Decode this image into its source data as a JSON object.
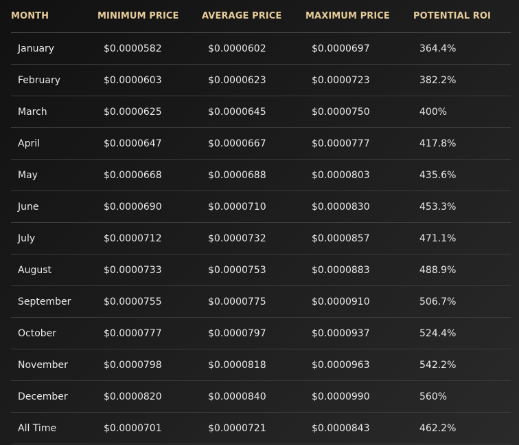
{
  "columns": {
    "month": "MONTH",
    "min": "MINIMUM PRICE",
    "avg": "AVERAGE PRICE",
    "max": "MAXIMUM PRICE",
    "roi": "POTENTIAL ROI"
  },
  "rows": [
    {
      "month": "January",
      "min": "$0.0000582",
      "avg": "$0.0000602",
      "max": "$0.0000697",
      "roi": "364.4%"
    },
    {
      "month": "February",
      "min": "$0.0000603",
      "avg": "$0.0000623",
      "max": "$0.0000723",
      "roi": "382.2%"
    },
    {
      "month": "March",
      "min": "$0.0000625",
      "avg": "$0.0000645",
      "max": "$0.0000750",
      "roi": "400%"
    },
    {
      "month": "April",
      "min": "$0.0000647",
      "avg": "$0.0000667",
      "max": "$0.0000777",
      "roi": "417.8%"
    },
    {
      "month": "May",
      "min": "$0.0000668",
      "avg": "$0.0000688",
      "max": "$0.0000803",
      "roi": "435.6%"
    },
    {
      "month": "June",
      "min": "$0.0000690",
      "avg": "$0.0000710",
      "max": "$0.0000830",
      "roi": "453.3%"
    },
    {
      "month": "July",
      "min": "$0.0000712",
      "avg": "$0.0000732",
      "max": "$0.0000857",
      "roi": "471.1%"
    },
    {
      "month": "August",
      "min": "$0.0000733",
      "avg": "$0.0000753",
      "max": "$0.0000883",
      "roi": "488.9%"
    },
    {
      "month": "September",
      "min": "$0.0000755",
      "avg": "$0.0000775",
      "max": "$0.0000910",
      "roi": "506.7%"
    },
    {
      "month": "October",
      "min": "$0.0000777",
      "avg": "$0.0000797",
      "max": "$0.0000937",
      "roi": "524.4%"
    },
    {
      "month": "November",
      "min": "$0.0000798",
      "avg": "$0.0000818",
      "max": "$0.0000963",
      "roi": "542.2%"
    },
    {
      "month": "December",
      "min": "$0.0000820",
      "avg": "$0.0000840",
      "max": "$0.0000990",
      "roi": "560%"
    },
    {
      "month": "All Time",
      "min": "$0.0000701",
      "avg": "$0.0000721",
      "max": "$0.0000843",
      "roi": "462.2%"
    }
  ]
}
